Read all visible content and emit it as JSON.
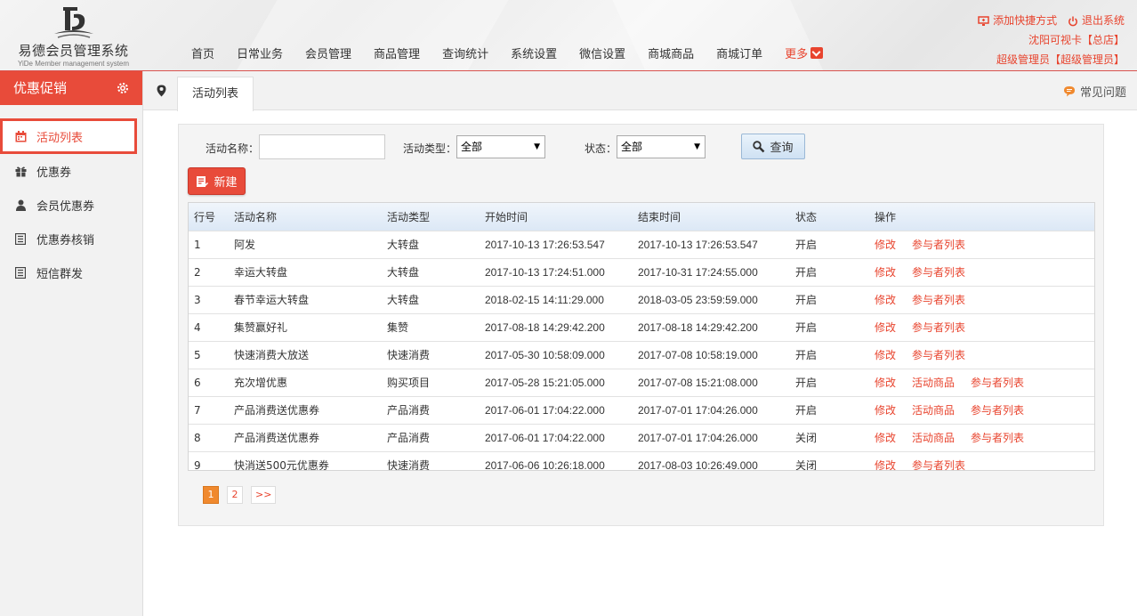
{
  "header": {
    "logo_title": "易德会员管理系统",
    "logo_sub": "YiDe Member management system",
    "nav": [
      "首页",
      "日常业务",
      "会员管理",
      "商品管理",
      "查询统计",
      "系统设置",
      "微信设置",
      "商城商品",
      "商城订单"
    ],
    "more": "更多",
    "add_shortcut": "添加快捷方式",
    "logout": "退出系统",
    "store": "沈阳可视卡【总店】",
    "user": "超级管理员【超级管理员】",
    "accent": "#e8442e"
  },
  "sidebar": {
    "title": "优惠促销",
    "items": [
      {
        "label": "活动列表",
        "icon": "calendar-icon"
      },
      {
        "label": "优惠券",
        "icon": "gift-icon"
      },
      {
        "label": "会员优惠券",
        "icon": "user-icon"
      },
      {
        "label": "优惠券核销",
        "icon": "list-icon"
      },
      {
        "label": "短信群发",
        "icon": "list-icon"
      }
    ]
  },
  "tabs": {
    "active": "活动列表",
    "faq": "常见问题"
  },
  "filter": {
    "name_label": "活动名称：",
    "name_value": "",
    "type_label": "活动类型：",
    "type_value": "全部",
    "status_label": "状态：",
    "status_value": "全部",
    "query": "查询",
    "new": "新建"
  },
  "table": {
    "headers": [
      "行号",
      "活动名称",
      "活动类型",
      "开始时间",
      "结束时间",
      "状态",
      "操作"
    ],
    "rows": [
      {
        "no": "1",
        "name": "阿发",
        "type": "大转盘",
        "start": "2017-10-13 17:26:53.547",
        "end": "2017-10-13 17:26:53.547",
        "status": "开启",
        "ops": [
          "修改",
          "参与者列表"
        ]
      },
      {
        "no": "2",
        "name": "幸运大转盘",
        "type": "大转盘",
        "start": "2017-10-13 17:24:51.000",
        "end": "2017-10-31 17:24:55.000",
        "status": "开启",
        "ops": [
          "修改",
          "参与者列表"
        ]
      },
      {
        "no": "3",
        "name": "春节幸运大转盘",
        "type": "大转盘",
        "start": "2018-02-15 14:11:29.000",
        "end": "2018-03-05 23:59:59.000",
        "status": "开启",
        "ops": [
          "修改",
          "参与者列表"
        ]
      },
      {
        "no": "4",
        "name": "集赞赢好礼",
        "type": "集赞",
        "start": "2017-08-18 14:29:42.200",
        "end": "2017-08-18 14:29:42.200",
        "status": "开启",
        "ops": [
          "修改",
          "参与者列表"
        ]
      },
      {
        "no": "5",
        "name": "快速消费大放送",
        "type": "快速消费",
        "start": "2017-05-30 10:58:09.000",
        "end": "2017-07-08 10:58:19.000",
        "status": "开启",
        "ops": [
          "修改",
          "参与者列表"
        ]
      },
      {
        "no": "6",
        "name": "充次增优惠",
        "type": "购买项目",
        "start": "2017-05-28 15:21:05.000",
        "end": "2017-07-08 15:21:08.000",
        "status": "开启",
        "ops": [
          "修改",
          "活动商品",
          "参与者列表"
        ]
      },
      {
        "no": "7",
        "name": "产品消费送优惠券",
        "type": "产品消费",
        "start": "2017-06-01 17:04:22.000",
        "end": "2017-07-01 17:04:26.000",
        "status": "开启",
        "ops": [
          "修改",
          "活动商品",
          "参与者列表"
        ]
      },
      {
        "no": "8",
        "name": "产品消费送优惠券",
        "type": "产品消费",
        "start": "2017-06-01 17:04:22.000",
        "end": "2017-07-01 17:04:26.000",
        "status": "关闭",
        "ops": [
          "修改",
          "活动商品",
          "参与者列表"
        ]
      },
      {
        "no": "9",
        "name": "快消送500元优惠券",
        "type": "快速消费",
        "start": "2017-06-06 10:26:18.000",
        "end": "2017-08-03 10:26:49.000",
        "status": "关闭",
        "ops": [
          "修改",
          "参与者列表"
        ]
      }
    ]
  },
  "pager": {
    "pages": [
      "1",
      "2"
    ],
    "current": "1",
    "next": ">>"
  }
}
